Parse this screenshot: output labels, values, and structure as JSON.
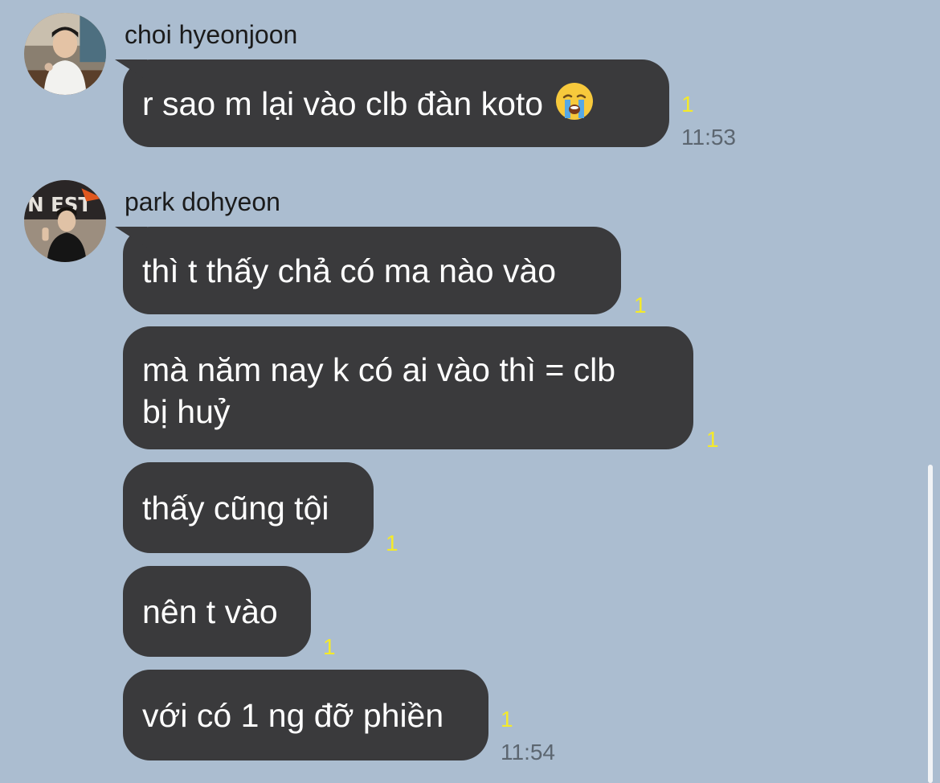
{
  "colors": {
    "background": "#abbdd0",
    "bubble": "#3a3a3c",
    "bubble_text": "#ffffff",
    "unread_count": "#f4ea2a",
    "timestamp": "#5c6670"
  },
  "messages": [
    {
      "sender": "choi hyeonjoon",
      "avatar_icon": "profile-photo",
      "bubbles": [
        {
          "text": "r sao m lại vào clb đàn koto",
          "emoji": "loudly-crying-face-icon",
          "unread": "1",
          "time": "11:53"
        }
      ]
    },
    {
      "sender": "park dohyeon",
      "avatar_icon": "profile-photo",
      "bubbles": [
        {
          "text": "thì t thấy chả có ma nào vào",
          "unread": "1"
        },
        {
          "text": "mà năm nay k có ai vào thì = clb\nbị huỷ",
          "unread": "1"
        },
        {
          "text": "thấy cũng tội",
          "unread": "1"
        },
        {
          "text": "nên t vào",
          "unread": "1"
        },
        {
          "text": "với có 1 ng đỡ phiền",
          "unread": "1",
          "time": "11:54"
        }
      ]
    }
  ]
}
